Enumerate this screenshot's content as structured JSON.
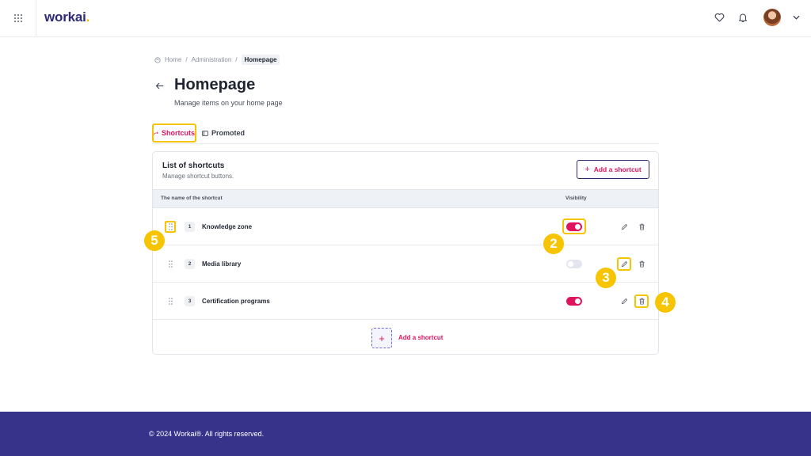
{
  "app": {
    "logo_text": "workai",
    "logo_dot": "."
  },
  "breadcrumb": {
    "home": "Home",
    "sep1": "/",
    "administration": "Administration",
    "sep2": "/",
    "current": "Homepage"
  },
  "header": {
    "title": "Homepage",
    "subtitle": "Manage items on your home page"
  },
  "tabs": [
    {
      "label": "Shortcuts",
      "active": true
    },
    {
      "label": "Promoted",
      "active": false
    }
  ],
  "card": {
    "title": "List of shortcuts",
    "subtitle": "Manage shortcut buttons.",
    "add_button": "Add a shortcut",
    "columns": {
      "name": "The name of the shortcut",
      "visibility": "Visibility"
    },
    "rows": [
      {
        "number": "1",
        "name": "Knowledge zone",
        "visible": true
      },
      {
        "number": "2",
        "name": "Media library",
        "visible": false
      },
      {
        "number": "3",
        "name": "Certification programs",
        "visible": true
      }
    ],
    "add_row_label": "Add a shortcut"
  },
  "callouts": [
    "2",
    "3",
    "4",
    "5"
  ],
  "colors": {
    "accent": "#e0135f",
    "brand": "#2d2a7a",
    "highlight": "#f7c400",
    "footer": "#37338a"
  },
  "footer": {
    "copyright": "© 2024 Workai®. All rights reserved."
  }
}
